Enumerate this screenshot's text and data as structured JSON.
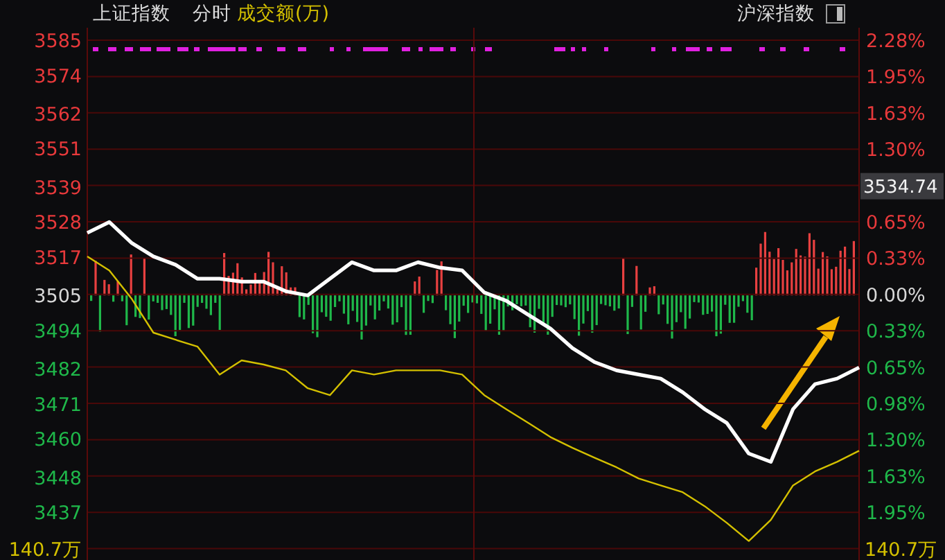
{
  "header": {
    "index_name": "上证指数",
    "mode": "分时",
    "indicator": "成交额(万)",
    "market": "沪深指数"
  },
  "chart": {
    "right_axis": [
      {
        "label": "2.28%",
        "kind": "up"
      },
      {
        "label": "1.95%",
        "kind": "up"
      },
      {
        "label": "1.63%",
        "kind": "up"
      },
      {
        "label": "1.30%",
        "kind": "up"
      },
      {
        "label": "3534.74",
        "kind": "cursor"
      },
      {
        "label": "0.65%",
        "kind": "up"
      },
      {
        "label": "0.33%",
        "kind": "up"
      },
      {
        "label": "0.00%",
        "kind": "flat"
      },
      {
        "label": "0.33%",
        "kind": "down"
      },
      {
        "label": "0.65%",
        "kind": "down"
      },
      {
        "label": "0.98%",
        "kind": "down"
      },
      {
        "label": "1.30%",
        "kind": "down"
      },
      {
        "label": "1.63%",
        "kind": "down"
      },
      {
        "label": "1.95%",
        "kind": "down"
      }
    ],
    "volume_scale_left": "140.7万",
    "volume_scale_right": "140.7万",
    "chart_data": {
      "type": "line",
      "grid": true,
      "ylim": [
        3425.6,
        3585
      ],
      "yticks": [
        {
          "value": 3585,
          "label": "3585"
        },
        {
          "value": 3574,
          "label": "3574"
        },
        {
          "value": 3562,
          "label": "3562"
        },
        {
          "value": 3551,
          "label": "3551"
        },
        {
          "value": 3539,
          "label": "3539"
        },
        {
          "value": 3528,
          "label": "3528"
        },
        {
          "value": 3517,
          "label": "3517"
        },
        {
          "value": 3505,
          "label": "3505"
        },
        {
          "value": 3494,
          "label": "3494"
        },
        {
          "value": 3482,
          "label": "3482"
        },
        {
          "value": 3471,
          "label": "3471"
        },
        {
          "value": 3460,
          "label": "3460"
        },
        {
          "value": 3448,
          "label": "3448"
        },
        {
          "value": 3437,
          "label": "3437"
        }
      ],
      "series": [
        {
          "color": "#ffffff",
          "values": [
            3524.6,
            3528.0,
            3521.5,
            3517.2,
            3514.6,
            3510.2,
            3510.2,
            3509.3,
            3509.3,
            3506.3,
            3505.0,
            3510.2,
            3515.4,
            3512.8,
            3512.8,
            3515.4,
            3513.7,
            3512.8,
            3505.9,
            3503.3,
            3498.9,
            3494.6,
            3488.5,
            3484.1,
            3481.5,
            3480.2,
            3478.9,
            3474.6,
            3469.3,
            3465.0,
            3455.4,
            3452.8,
            3469.3,
            3477.2,
            3478.9,
            3482.4
          ]
        },
        {
          "color": "#d4c000",
          "values": [
            3517.2,
            3512.8,
            3504.1,
            3493.3,
            3491.1,
            3488.9,
            3480.2,
            3484.6,
            3483.3,
            3481.5,
            3475.9,
            3473.7,
            3481.5,
            3480.2,
            3481.5,
            3481.5,
            3481.5,
            3480.2,
            3473.7,
            3469.3,
            3465.0,
            3460.6,
            3457.2,
            3454.1,
            3451.1,
            3447.6,
            3445.4,
            3443.3,
            3438.9,
            3433.7,
            3428.0,
            3434.6,
            3445.4,
            3449.8,
            3452.8,
            3456.3
          ]
        }
      ]
    }
  }
}
